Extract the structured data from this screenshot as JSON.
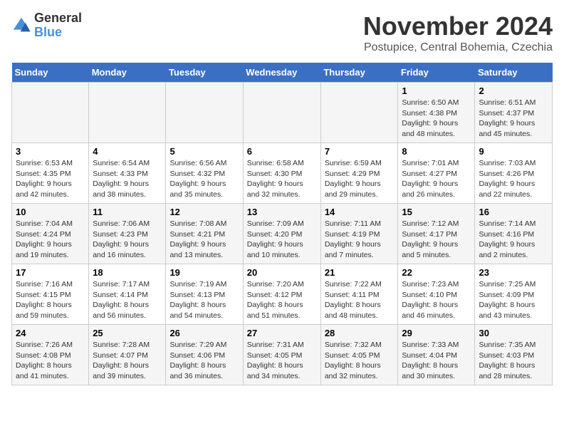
{
  "logo": {
    "text_general": "General",
    "text_blue": "Blue"
  },
  "title": {
    "month": "November 2024",
    "location": "Postupice, Central Bohemia, Czechia"
  },
  "calendar": {
    "headers": [
      "Sunday",
      "Monday",
      "Tuesday",
      "Wednesday",
      "Thursday",
      "Friday",
      "Saturday"
    ],
    "weeks": [
      {
        "days": [
          {
            "date": "",
            "info": ""
          },
          {
            "date": "",
            "info": ""
          },
          {
            "date": "",
            "info": ""
          },
          {
            "date": "",
            "info": ""
          },
          {
            "date": "",
            "info": ""
          },
          {
            "date": "1",
            "info": "Sunrise: 6:50 AM\nSunset: 4:38 PM\nDaylight: 9 hours and 48 minutes."
          },
          {
            "date": "2",
            "info": "Sunrise: 6:51 AM\nSunset: 4:37 PM\nDaylight: 9 hours and 45 minutes."
          }
        ]
      },
      {
        "days": [
          {
            "date": "3",
            "info": "Sunrise: 6:53 AM\nSunset: 4:35 PM\nDaylight: 9 hours and 42 minutes."
          },
          {
            "date": "4",
            "info": "Sunrise: 6:54 AM\nSunset: 4:33 PM\nDaylight: 9 hours and 38 minutes."
          },
          {
            "date": "5",
            "info": "Sunrise: 6:56 AM\nSunset: 4:32 PM\nDaylight: 9 hours and 35 minutes."
          },
          {
            "date": "6",
            "info": "Sunrise: 6:58 AM\nSunset: 4:30 PM\nDaylight: 9 hours and 32 minutes."
          },
          {
            "date": "7",
            "info": "Sunrise: 6:59 AM\nSunset: 4:29 PM\nDaylight: 9 hours and 29 minutes."
          },
          {
            "date": "8",
            "info": "Sunrise: 7:01 AM\nSunset: 4:27 PM\nDaylight: 9 hours and 26 minutes."
          },
          {
            "date": "9",
            "info": "Sunrise: 7:03 AM\nSunset: 4:26 PM\nDaylight: 9 hours and 22 minutes."
          }
        ]
      },
      {
        "days": [
          {
            "date": "10",
            "info": "Sunrise: 7:04 AM\nSunset: 4:24 PM\nDaylight: 9 hours and 19 minutes."
          },
          {
            "date": "11",
            "info": "Sunrise: 7:06 AM\nSunset: 4:23 PM\nDaylight: 9 hours and 16 minutes."
          },
          {
            "date": "12",
            "info": "Sunrise: 7:08 AM\nSunset: 4:21 PM\nDaylight: 9 hours and 13 minutes."
          },
          {
            "date": "13",
            "info": "Sunrise: 7:09 AM\nSunset: 4:20 PM\nDaylight: 9 hours and 10 minutes."
          },
          {
            "date": "14",
            "info": "Sunrise: 7:11 AM\nSunset: 4:19 PM\nDaylight: 9 hours and 7 minutes."
          },
          {
            "date": "15",
            "info": "Sunrise: 7:12 AM\nSunset: 4:17 PM\nDaylight: 9 hours and 5 minutes."
          },
          {
            "date": "16",
            "info": "Sunrise: 7:14 AM\nSunset: 4:16 PM\nDaylight: 9 hours and 2 minutes."
          }
        ]
      },
      {
        "days": [
          {
            "date": "17",
            "info": "Sunrise: 7:16 AM\nSunset: 4:15 PM\nDaylight: 8 hours and 59 minutes."
          },
          {
            "date": "18",
            "info": "Sunrise: 7:17 AM\nSunset: 4:14 PM\nDaylight: 8 hours and 56 minutes."
          },
          {
            "date": "19",
            "info": "Sunrise: 7:19 AM\nSunset: 4:13 PM\nDaylight: 8 hours and 54 minutes."
          },
          {
            "date": "20",
            "info": "Sunrise: 7:20 AM\nSunset: 4:12 PM\nDaylight: 8 hours and 51 minutes."
          },
          {
            "date": "21",
            "info": "Sunrise: 7:22 AM\nSunset: 4:11 PM\nDaylight: 8 hours and 48 minutes."
          },
          {
            "date": "22",
            "info": "Sunrise: 7:23 AM\nSunset: 4:10 PM\nDaylight: 8 hours and 46 minutes."
          },
          {
            "date": "23",
            "info": "Sunrise: 7:25 AM\nSunset: 4:09 PM\nDaylight: 8 hours and 43 minutes."
          }
        ]
      },
      {
        "days": [
          {
            "date": "24",
            "info": "Sunrise: 7:26 AM\nSunset: 4:08 PM\nDaylight: 8 hours and 41 minutes."
          },
          {
            "date": "25",
            "info": "Sunrise: 7:28 AM\nSunset: 4:07 PM\nDaylight: 8 hours and 39 minutes."
          },
          {
            "date": "26",
            "info": "Sunrise: 7:29 AM\nSunset: 4:06 PM\nDaylight: 8 hours and 36 minutes."
          },
          {
            "date": "27",
            "info": "Sunrise: 7:31 AM\nSunset: 4:05 PM\nDaylight: 8 hours and 34 minutes."
          },
          {
            "date": "28",
            "info": "Sunrise: 7:32 AM\nSunset: 4:05 PM\nDaylight: 8 hours and 32 minutes."
          },
          {
            "date": "29",
            "info": "Sunrise: 7:33 AM\nSunset: 4:04 PM\nDaylight: 8 hours and 30 minutes."
          },
          {
            "date": "30",
            "info": "Sunrise: 7:35 AM\nSunset: 4:03 PM\nDaylight: 8 hours and 28 minutes."
          }
        ]
      }
    ]
  }
}
